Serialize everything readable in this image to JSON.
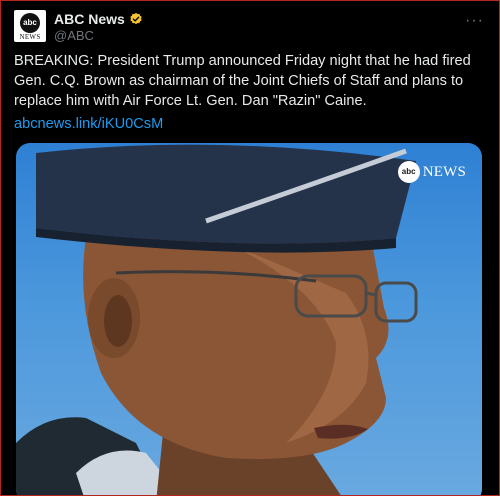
{
  "account": {
    "avatar_circle_text": "abc",
    "avatar_word": "NEWS",
    "display_name": "ABC News",
    "handle": "@ABC",
    "verified_color": "#f4c430"
  },
  "menu": {
    "more_label": "···"
  },
  "tweet": {
    "text": "BREAKING: President Trump announced Friday night that he had fired Gen. C.Q. Brown as chairman of the Joint Chiefs of Staff and plans to replace him with Air Force Lt. Gen. Dan \"Razin\" Caine.",
    "link": "abcnews.link/iKU0CsM"
  },
  "media": {
    "watermark_circle": "abc",
    "watermark_word": "NEWS"
  },
  "colors": {
    "background": "#000000",
    "text": "#e7e9ea",
    "muted": "#71767b",
    "link": "#1d9bf0"
  }
}
